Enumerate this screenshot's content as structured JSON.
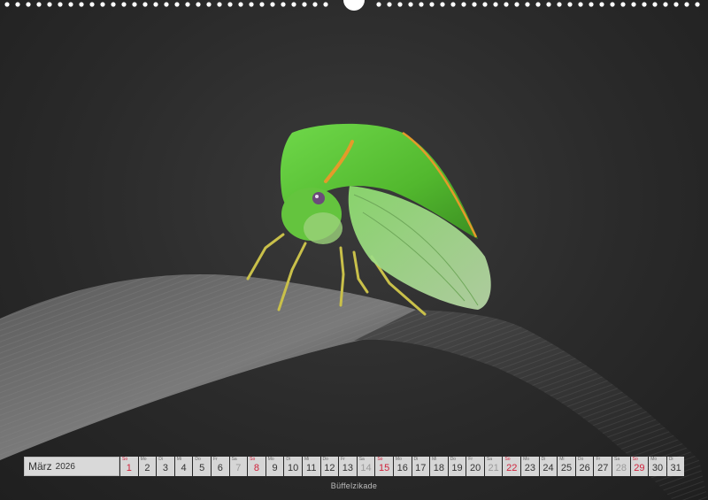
{
  "calendar": {
    "month": "März",
    "year": "2026",
    "days": [
      {
        "wd": "So",
        "d": "1",
        "type": "sun"
      },
      {
        "wd": "Mo",
        "d": "2",
        "type": "wk"
      },
      {
        "wd": "Di",
        "d": "3",
        "type": "wk"
      },
      {
        "wd": "Mi",
        "d": "4",
        "type": "wk"
      },
      {
        "wd": "Do",
        "d": "5",
        "type": "wk"
      },
      {
        "wd": "Fr",
        "d": "6",
        "type": "wk"
      },
      {
        "wd": "Sa",
        "d": "7",
        "type": "sat"
      },
      {
        "wd": "So",
        "d": "8",
        "type": "sun"
      },
      {
        "wd": "Mo",
        "d": "9",
        "type": "wk"
      },
      {
        "wd": "Di",
        "d": "10",
        "type": "wk"
      },
      {
        "wd": "Mi",
        "d": "11",
        "type": "wk"
      },
      {
        "wd": "Do",
        "d": "12",
        "type": "wk"
      },
      {
        "wd": "Fr",
        "d": "13",
        "type": "wk"
      },
      {
        "wd": "Sa",
        "d": "14",
        "type": "sat"
      },
      {
        "wd": "So",
        "d": "15",
        "type": "sun"
      },
      {
        "wd": "Mo",
        "d": "16",
        "type": "wk"
      },
      {
        "wd": "Di",
        "d": "17",
        "type": "wk"
      },
      {
        "wd": "Mi",
        "d": "18",
        "type": "wk"
      },
      {
        "wd": "Do",
        "d": "19",
        "type": "wk"
      },
      {
        "wd": "Fr",
        "d": "20",
        "type": "wk"
      },
      {
        "wd": "Sa",
        "d": "21",
        "type": "sat"
      },
      {
        "wd": "So",
        "d": "22",
        "type": "sun"
      },
      {
        "wd": "Mo",
        "d": "23",
        "type": "wk"
      },
      {
        "wd": "Di",
        "d": "24",
        "type": "wk"
      },
      {
        "wd": "Mi",
        "d": "25",
        "type": "wk"
      },
      {
        "wd": "Do",
        "d": "26",
        "type": "wk"
      },
      {
        "wd": "Fr",
        "d": "27",
        "type": "wk"
      },
      {
        "wd": "Sa",
        "d": "28",
        "type": "sat"
      },
      {
        "wd": "So",
        "d": "29",
        "type": "sun"
      },
      {
        "wd": "Mo",
        "d": "30",
        "type": "wk"
      },
      {
        "wd": "Di",
        "d": "31",
        "type": "wk"
      }
    ]
  },
  "caption": "Büffelzikade",
  "colors": {
    "sunday": "#d0213a",
    "saturday": "#9a9a9a",
    "cell": "#d6d6d6",
    "insect_green": "#5fc43a",
    "leaf": "#6a6a6a"
  },
  "icons": {
    "binding": "spiral-binding-icon"
  }
}
